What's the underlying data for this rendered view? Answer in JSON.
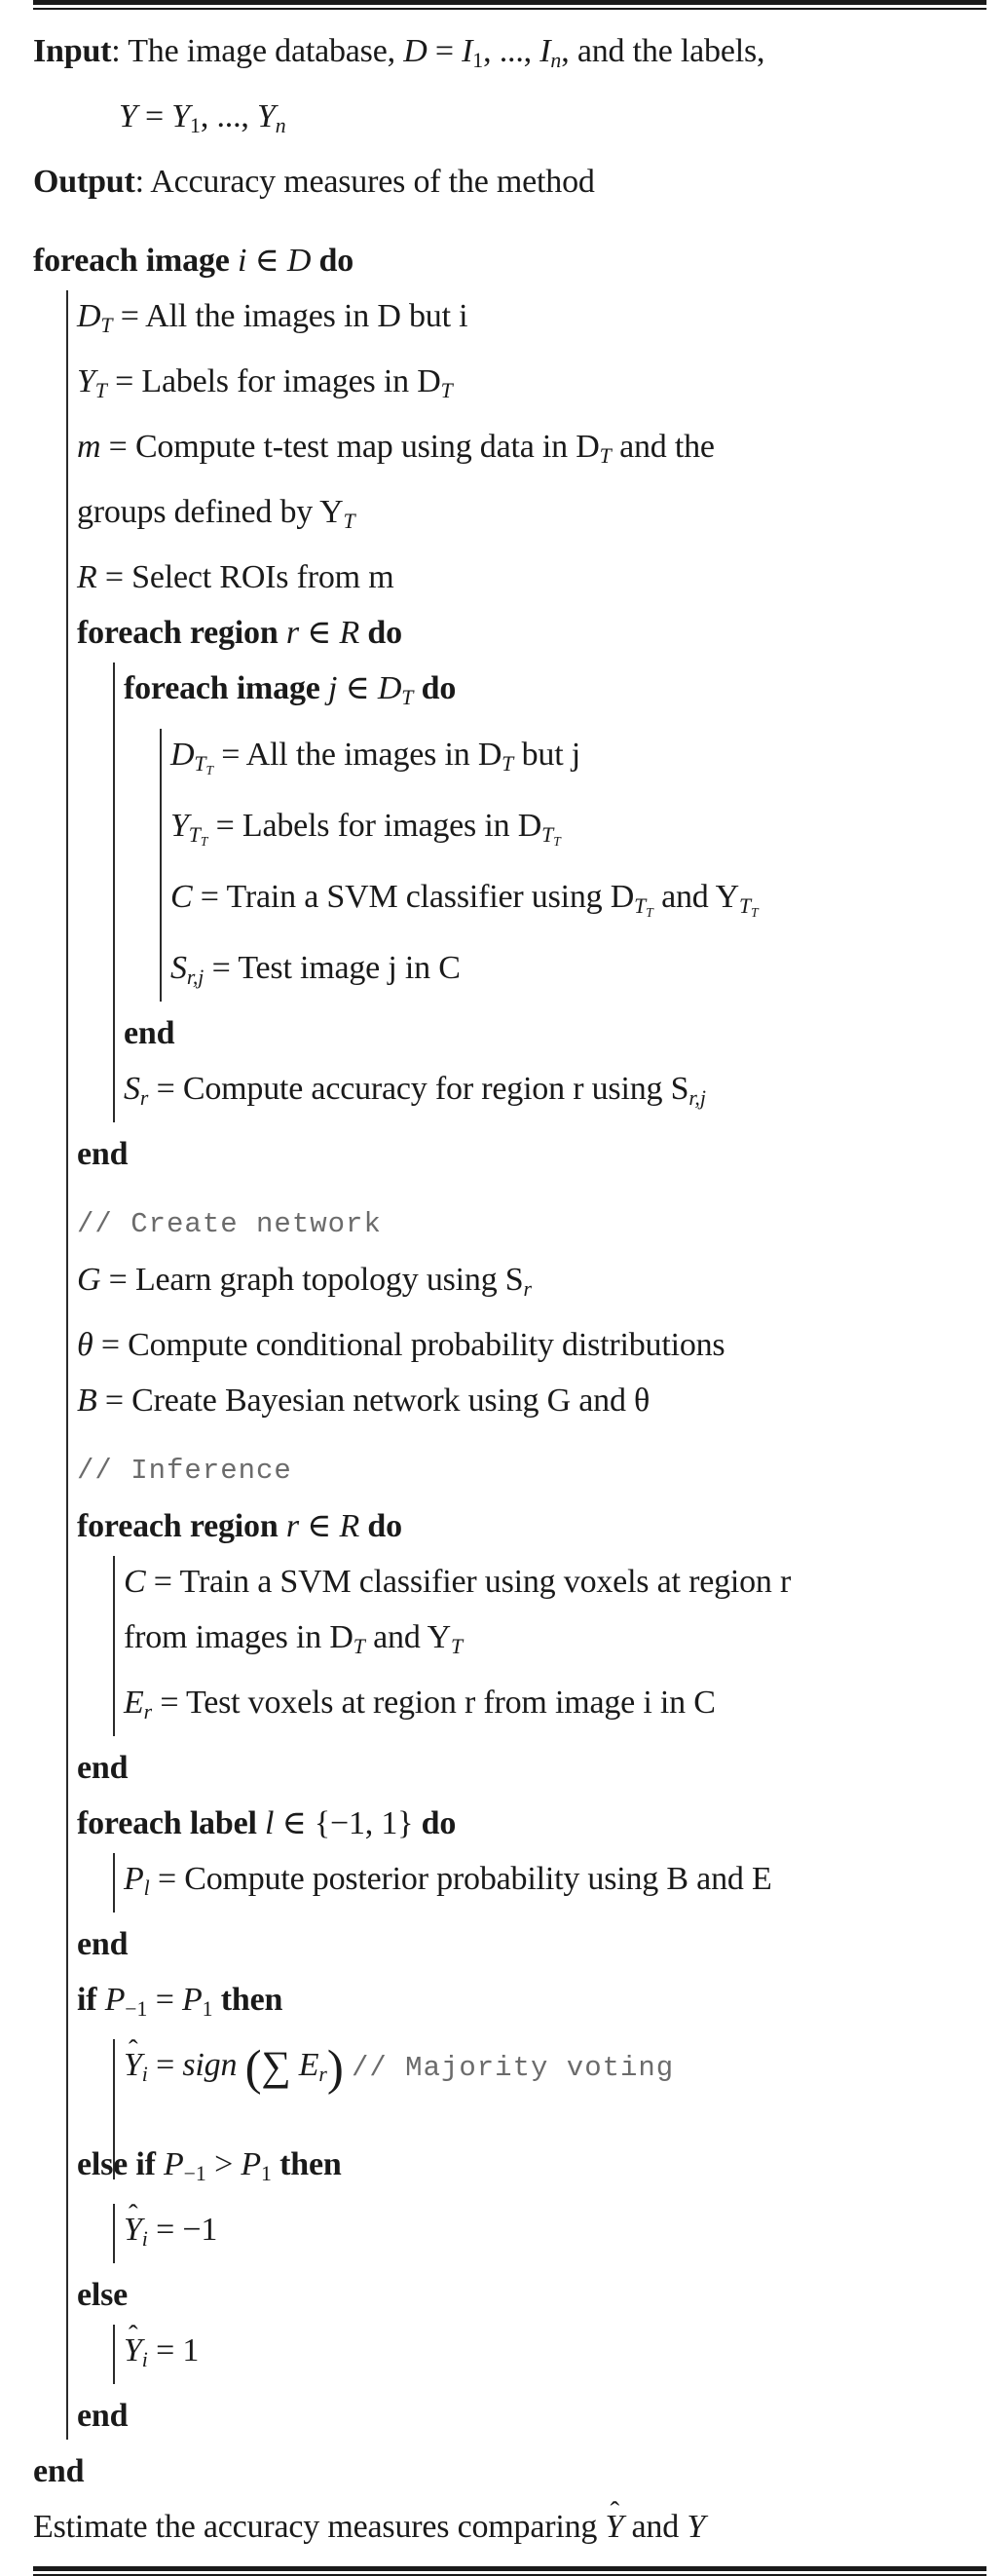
{
  "algorithm": {
    "io": {
      "input_label": "Input",
      "input_text_1": ": The image database, ",
      "input_math_1": "D = I₁, ..., Iₙ, and the labels,",
      "input_math_2": "Y = Y₁, ..., Yₙ",
      "output_label": "Output",
      "output_text": ": Accuracy measures of the method"
    },
    "lines": {
      "l01_foreach": "foreach",
      "l01_image": "image",
      "l01_var": "i",
      "l01_in": "∈",
      "l01_set": "D",
      "l01_do": "do",
      "l02": "= All the images in D but i",
      "l03": "= Labels for images in D",
      "l04": "= Compute t-test map using data in D",
      "l04b": "and the",
      "l05": "groups defined by Y",
      "l06": "= Select ROIs from m",
      "l07_foreach": "foreach",
      "l07_region": "region",
      "l07_var": "r",
      "l07_set": "R",
      "l07_do": "do",
      "l08_foreach": "foreach",
      "l08_image": "image",
      "l08_var": "j",
      "l08_set": "D",
      "l08_do": "do",
      "l09": "= All the images in D",
      "l09b": "but j",
      "l10": "= Labels for images in D",
      "l11": "= Train a SVM classifier using D",
      "l11b": "and Y",
      "l12": "= Test image j in C",
      "l13_end": "end",
      "l14": "= Compute accuracy for region r using S",
      "l15_end": "end",
      "c01": "// Create network",
      "l16": "= Learn graph topology using S",
      "l17": "= Compute conditional probability distributions",
      "l18": "= Create Bayesian network using G and θ",
      "c02": "// Inference",
      "l19_foreach": "foreach",
      "l19_region": "region",
      "l19_var": "r",
      "l19_set": "R",
      "l19_do": "do",
      "l20": "= Train a SVM classifier using voxels at region r",
      "l21": "from images in D",
      "l21b": "and Y",
      "l22": "= Test voxels at region r from image i in C",
      "l23_end": "end",
      "l24_foreach": "foreach",
      "l24_label": "label",
      "l24_var": "l",
      "l24_set": "{−1, 1}",
      "l24_do": "do",
      "l25": "= Compute posterior probability using B and E",
      "l26_end": "end",
      "l27_if": "if",
      "l27_cond_lhs": "P",
      "l27_cond_lhs_sub": "−1",
      "l27_eq": "=",
      "l27_cond_rhs": "P",
      "l27_cond_rhs_sub": "1",
      "l27_then": "then",
      "l28_lhs": "Y",
      "l28_lhs_sub": "i",
      "l28_eq": "=",
      "l28_fn": "sign",
      "l28_sum": "∑",
      "l28_arg": "E",
      "l28_arg_sub": "r",
      "l28_comment": "// Majority voting",
      "l29_elseif": "else if",
      "l29_gt": ">",
      "l29_then": "then",
      "l30_val": "= −1",
      "l31_else": "else",
      "l32_val": "= 1",
      "l33_end": "end",
      "l34_end": "end",
      "l35": "Estimate the accuracy measures comparing "
    },
    "symbols": {
      "D": "D",
      "Y": "Y",
      "T": "T",
      "m": "m",
      "R": "R",
      "C": "C",
      "S": "S",
      "G": "G",
      "B": "B",
      "E": "E",
      "P": "P",
      "theta": "θ",
      "r": "r",
      "j": "j",
      "i": "i",
      "l": "l",
      "rj": "r,j",
      "and": "and",
      "Yhat": "Y",
      "hat": "ˆ"
    }
  }
}
